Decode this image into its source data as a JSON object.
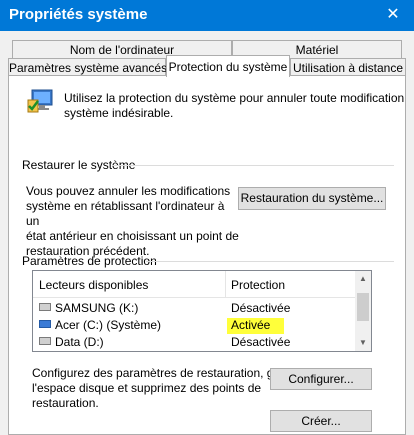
{
  "window": {
    "title": "Propriétés système",
    "close_glyph": "✕"
  },
  "tabs_row1": [
    "Nom de l'ordinateur",
    "Matériel"
  ],
  "tabs_row2": [
    "Paramètres système avancés",
    "Protection du système",
    "Utilisation à distance"
  ],
  "intro": {
    "text_line1": "Utilisez la protection du système pour annuler toute modification",
    "text_line2": "système indésirable."
  },
  "restore": {
    "heading": "Restaurer le système",
    "desc_line1": "Vous pouvez annuler les modifications",
    "desc_line2": "système en rétablissant l'ordinateur à un",
    "desc_line3": "état antérieur en choisissant un point de",
    "desc_line4": "restauration précédent.",
    "button": "Restauration du système..."
  },
  "protection": {
    "heading": "Paramètres de protection",
    "columns": [
      "Lecteurs disponibles",
      "Protection"
    ],
    "drives": [
      {
        "name": "SAMSUNG (K:)",
        "status": "Désactivée",
        "icon": "drive-icon"
      },
      {
        "name": "Acer (C:) (Système)",
        "status": "Activée",
        "icon": "system-drive-icon"
      },
      {
        "name": "Data (D:)",
        "status": "Désactivée",
        "icon": "drive-icon"
      }
    ]
  },
  "configure": {
    "desc_line1": "Configurez des paramètres de restauration, gérez",
    "desc_line2": "l'espace disque et supprimez des points de",
    "desc_line3": "restauration.",
    "button": "Configurer..."
  },
  "create_button": "Créer..."
}
